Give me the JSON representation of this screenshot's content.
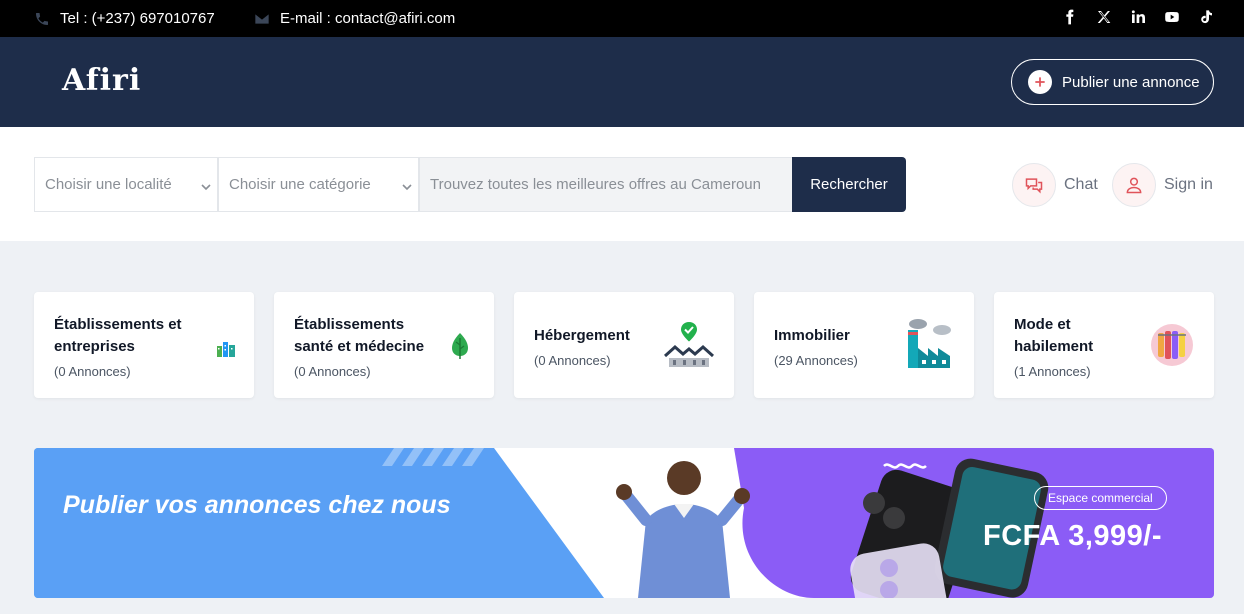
{
  "topbar": {
    "phone": "Tel : (+237) 697010767",
    "email": "E-mail : contact@afiri.com",
    "socials": [
      "facebook-icon",
      "x-icon",
      "linkedin-icon",
      "youtube-icon",
      "tiktok-icon"
    ]
  },
  "header": {
    "logo": "Afiri",
    "publish_label": "Publier une annonce"
  },
  "search": {
    "location_placeholder": "Choisir une localité",
    "category_placeholder": "Choisir une catégorie",
    "query_placeholder": "Trouvez toutes les meilleures offres au Cameroun",
    "button_label": "Rechercher",
    "chat_label": "Chat",
    "signin_label": "Sign in"
  },
  "categories": [
    {
      "title": "Établissements et entreprises",
      "count": "(0 Annonces)",
      "icon": "buildings-icon"
    },
    {
      "title": "Établissements santé et médecine",
      "count": "(0 Annonces)",
      "icon": "leaf-icon"
    },
    {
      "title": "Hébergement",
      "count": "(0 Annonces)",
      "icon": "houses-check-icon"
    },
    {
      "title": "Immobilier",
      "count": "(29 Annonces)",
      "icon": "factory-icon"
    },
    {
      "title": "Mode et habilement",
      "count": "(1 Annonces)",
      "icon": "fashion-icon"
    }
  ],
  "banner": {
    "headline": "Publier vos annonces chez nous",
    "pill": "Espace commercial",
    "price": "FCFA 3,999/-"
  },
  "colors": {
    "topbar": "#000000",
    "header": "#1e2d4a",
    "accent": "#e0535a",
    "banner_blue": "#5aa0f5",
    "banner_purple": "#8b5cf6"
  }
}
